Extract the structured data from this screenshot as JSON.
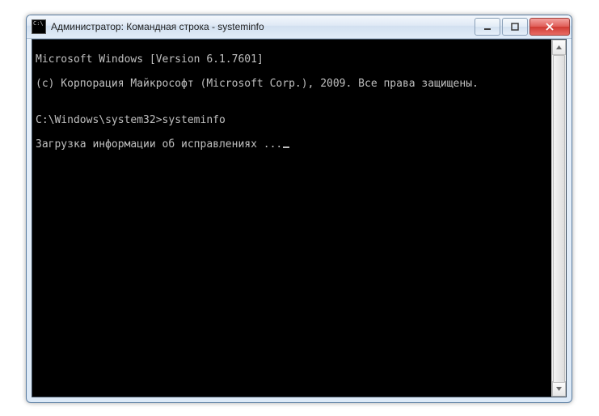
{
  "window": {
    "title": "Администратор: Командная строка - systeminfo"
  },
  "console": {
    "line1": "Microsoft Windows [Version 6.1.7601]",
    "line2": "(c) Корпорация Майкрософт (Microsoft Corp.), 2009. Все права защищены.",
    "blank1": "",
    "prompt_path": "C:\\Windows\\system32>",
    "command": "systeminfo",
    "loading": "Загрузка информации об исправлениях ...",
    "cursor": "_"
  }
}
